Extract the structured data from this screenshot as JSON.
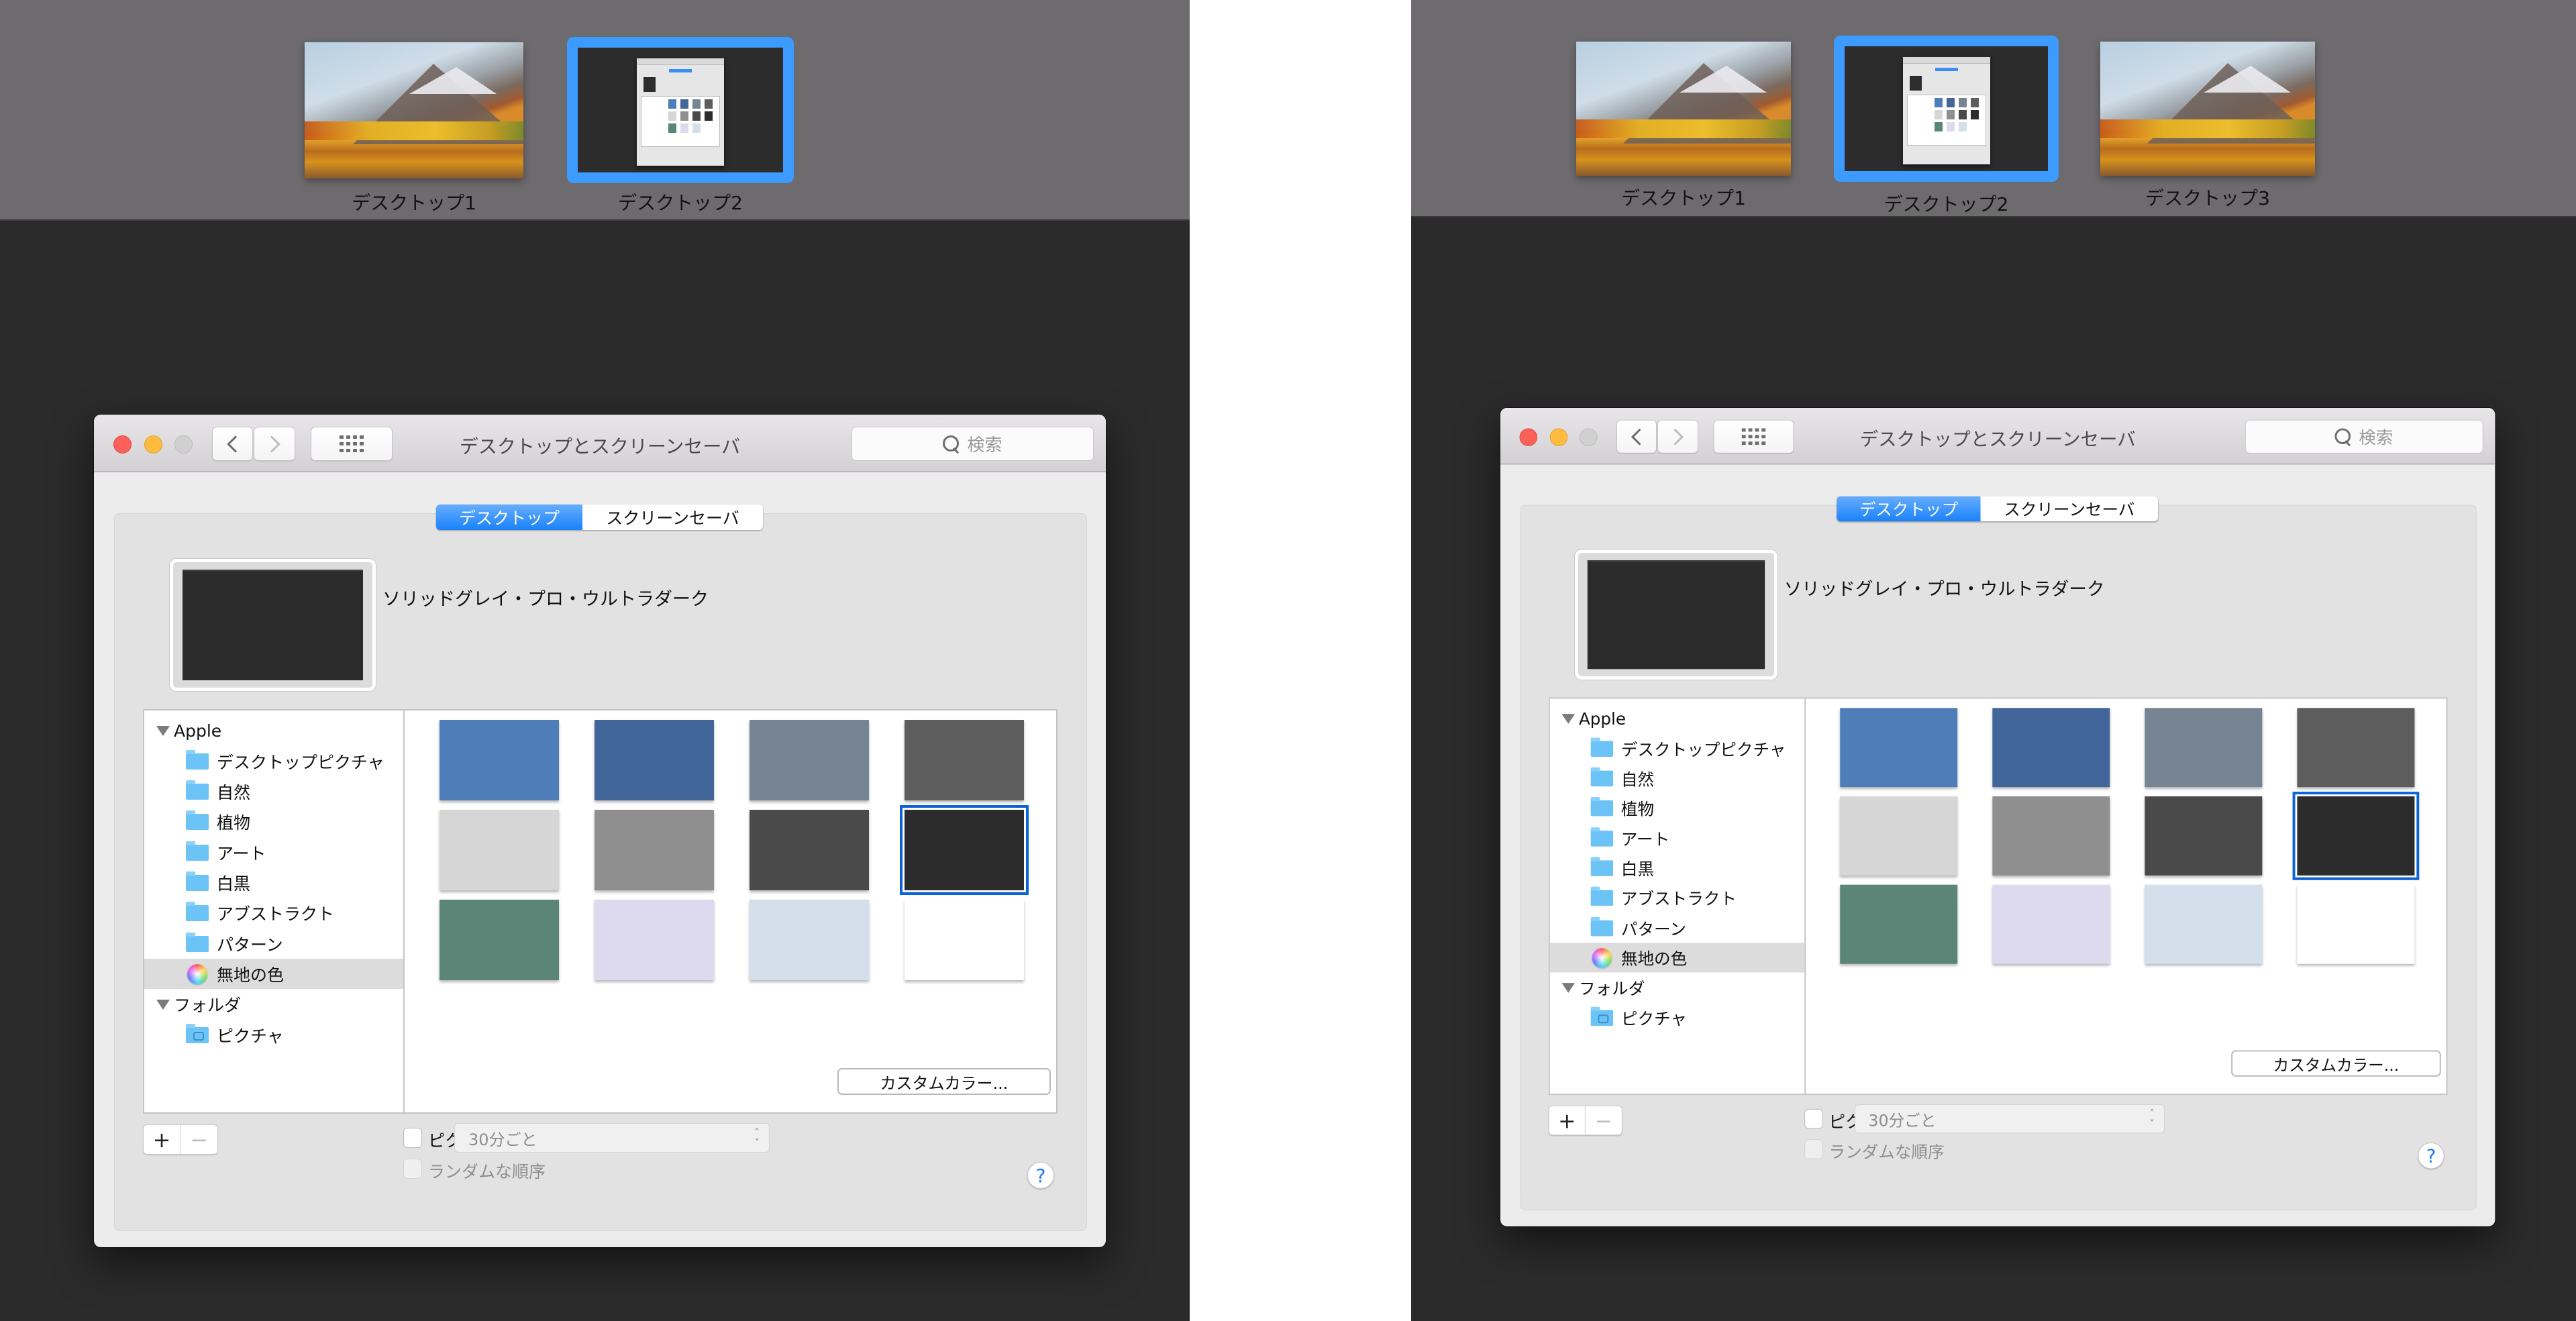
{
  "panels": [
    {
      "id": "left",
      "spaces": [
        {
          "label": "デスクトップ1",
          "kind": "wallpaper",
          "selected": false
        },
        {
          "label": "デスクトップ2",
          "kind": "dark",
          "selected": true
        }
      ]
    },
    {
      "id": "right",
      "spaces": [
        {
          "label": "デスクトップ1",
          "kind": "wallpaper",
          "selected": false
        },
        {
          "label": "デスクトップ2",
          "kind": "dark",
          "selected": true
        },
        {
          "label": "デスクトップ3",
          "kind": "wallpaper",
          "selected": false
        }
      ]
    }
  ],
  "window": {
    "title": "デスクトップとスクリーンセーバ",
    "search_placeholder": "検索",
    "tabs": [
      {
        "label": "デスクトップ",
        "active": true
      },
      {
        "label": "スクリーンセーバ",
        "active": false
      }
    ],
    "wallpaper_name": "ソリッドグレイ・プロ・ウルトラダーク",
    "source_list": [
      {
        "type": "group",
        "label": "Apple"
      },
      {
        "type": "folder",
        "label": "デスクトップピクチャ"
      },
      {
        "type": "folder",
        "label": "自然"
      },
      {
        "type": "folder",
        "label": "植物"
      },
      {
        "type": "folder",
        "label": "アート"
      },
      {
        "type": "folder",
        "label": "白黒"
      },
      {
        "type": "folder",
        "label": "アブストラクト"
      },
      {
        "type": "folder",
        "label": "パターン"
      },
      {
        "type": "colors",
        "label": "無地の色",
        "selected": true
      },
      {
        "type": "group",
        "label": "フォルダ"
      },
      {
        "type": "pictures",
        "label": "ピクチャ"
      }
    ],
    "swatches": [
      {
        "name": "blue",
        "color": "#4f7db8"
      },
      {
        "name": "dark-blue",
        "color": "#426699"
      },
      {
        "name": "slate",
        "color": "#778494"
      },
      {
        "name": "gray-dark",
        "color": "#5d5d5d"
      },
      {
        "name": "light-gray",
        "color": "#d6d6d6"
      },
      {
        "name": "medium-gray",
        "color": "#8f8f8f"
      },
      {
        "name": "charcoal",
        "color": "#4a4a4a"
      },
      {
        "name": "ultra-dark",
        "color": "#2c2c2c",
        "selected": true
      },
      {
        "name": "teal-green",
        "color": "#5a8577"
      },
      {
        "name": "lavender",
        "color": "#ddd9ee"
      },
      {
        "name": "pale-blue",
        "color": "#d3e0ec"
      },
      {
        "name": "white",
        "color": "#ffffff"
      }
    ],
    "custom_color_label": "カスタムカラー...",
    "add_label": "+",
    "remove_label": "−",
    "change_picture_label": "ピクチャを変更:",
    "change_picture_checked": false,
    "interval_value": "30分ごと",
    "random_order_label": "ランダムな順序",
    "random_order_checked": false,
    "help_label": "?"
  },
  "colors": {
    "accent": "#1a82fb",
    "selection_outline": "#0a63d8",
    "space_highlight": "#3d9bff",
    "mission_control_bar": "#6d6b6e",
    "desktop_bg": "#2b2b2b"
  }
}
